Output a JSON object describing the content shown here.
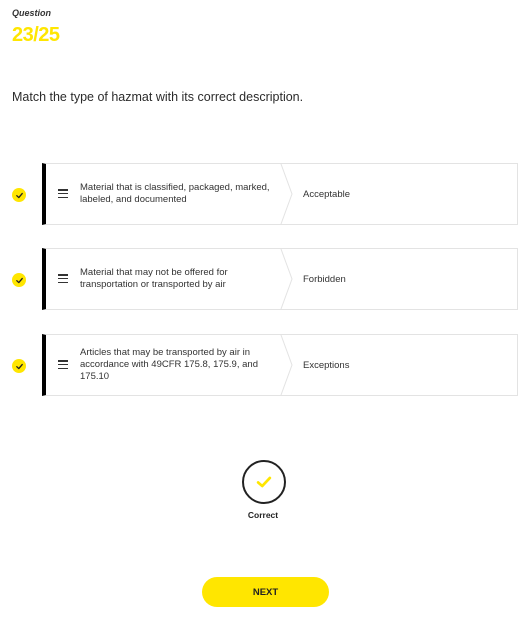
{
  "question": {
    "label": "Question",
    "counter": "23/25"
  },
  "prompt": "Match the type of hazmat with its correct description.",
  "matches": [
    {
      "description": "Material that is classified, packaged, marked, labeled, and documented",
      "answer": "Acceptable",
      "correct": true
    },
    {
      "description": "Material that may not be offered for transportation or transported by air",
      "answer": "Forbidden",
      "correct": true
    },
    {
      "description": "Articles that may be transported by air in accordance with 49CFR 175.8, 175.9, and 175.10",
      "answer": "Exceptions",
      "correct": true
    }
  ],
  "result": {
    "label": "Correct",
    "icon": "checkmark-icon"
  },
  "next_button": {
    "label": "NEXT"
  },
  "colors": {
    "accent": "#ffe600",
    "card_border": "#000000",
    "text": "#2b2b2b"
  }
}
